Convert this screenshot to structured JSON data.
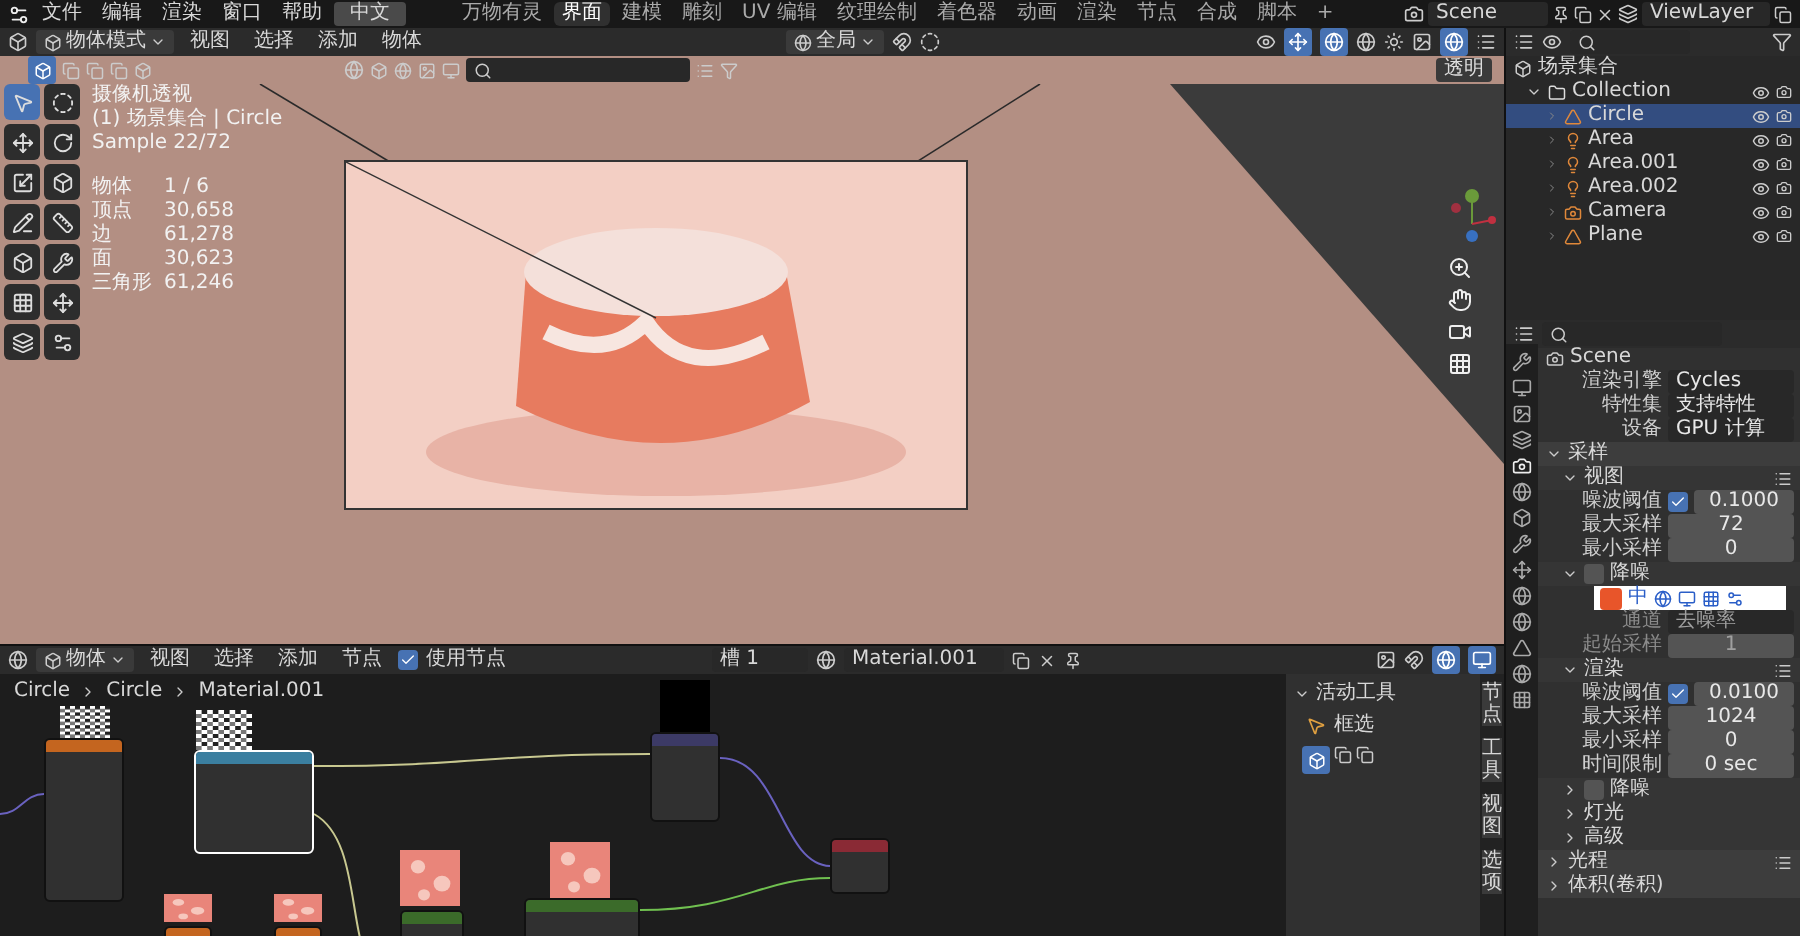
{
  "top_bar": {
    "menus": [
      {
        "label": "文件"
      },
      {
        "label": "编辑"
      },
      {
        "label": "渲染"
      },
      {
        "label": "窗口"
      },
      {
        "label": "帮助"
      }
    ],
    "language": "中文",
    "workspaces": [
      {
        "label": "万物有灵",
        "selected": false
      },
      {
        "label": "界面",
        "selected": true
      },
      {
        "label": "建模",
        "selected": false
      },
      {
        "label": "雕刻",
        "selected": false
      },
      {
        "label": "UV 编辑",
        "selected": false
      },
      {
        "label": "纹理绘制",
        "selected": false
      },
      {
        "label": "着色器",
        "selected": false
      },
      {
        "label": "动画",
        "selected": false
      },
      {
        "label": "渲染",
        "selected": false
      },
      {
        "label": "节点",
        "selected": false
      },
      {
        "label": "合成",
        "selected": false
      },
      {
        "label": "脚本",
        "selected": false
      },
      {
        "label": "+",
        "selected": false
      }
    ],
    "scene": "Scene",
    "view_layer": "ViewLayer"
  },
  "viewport": {
    "mode": "物体模式",
    "menus": [
      "视图",
      "选择",
      "添加",
      "物体"
    ],
    "orientation": "全局",
    "transparency": "透明",
    "tools": [
      {
        "selected": true
      },
      {
        "selected": false
      },
      {
        "selected": false
      },
      {
        "selected": false
      },
      {
        "selected": false
      },
      {
        "selected": false
      },
      {
        "selected": false
      },
      {
        "selected": false
      },
      {
        "selected": false
      },
      {
        "selected": false
      },
      {
        "selected": false
      },
      {
        "selected": false
      },
      {
        "selected": false
      },
      {
        "selected": false
      }
    ],
    "overlay_lines": [
      "摄像机透视",
      "(1) 场景集合 | Circle",
      "Sample 22/72"
    ],
    "stats": [
      {
        "label": "物体",
        "value": "1 / 6"
      },
      {
        "label": "顶点",
        "value": "30,658"
      },
      {
        "label": "边",
        "value": "61,278"
      },
      {
        "label": "面",
        "value": "30,623"
      },
      {
        "label": "三角形",
        "value": "61,246"
      }
    ]
  },
  "outliner": {
    "root": "场景集合",
    "items": [
      {
        "label": "Collection",
        "kind": "collection",
        "selected": false,
        "expanded": true,
        "children": [
          {
            "label": "Circle",
            "kind": "mesh",
            "selected": true
          },
          {
            "label": "Area",
            "kind": "light",
            "selected": false
          },
          {
            "label": "Area.001",
            "kind": "light",
            "selected": false
          },
          {
            "label": "Area.002",
            "kind": "light",
            "selected": false
          },
          {
            "label": "Camera",
            "kind": "camera",
            "selected": false
          },
          {
            "label": "Plane",
            "kind": "mesh",
            "selected": false
          }
        ]
      }
    ]
  },
  "properties": {
    "context": "Scene",
    "rows": [
      {
        "kind": "select",
        "label": "渲染引擎",
        "value": "Cycles",
        "disabled": false
      },
      {
        "kind": "select",
        "label": "特性集",
        "value": "支持特性",
        "disabled": false
      },
      {
        "kind": "select",
        "label": "设备",
        "value": "GPU 计算",
        "disabled": false
      },
      {
        "kind": "panel",
        "label": "采样",
        "expanded": true,
        "has_presets": false
      },
      {
        "kind": "subpanel",
        "label": "视图",
        "expanded": true,
        "has_presets": true
      },
      {
        "kind": "check_number",
        "label": "噪波阈值",
        "checked": true,
        "value": "0.1000",
        "disabled": false
      },
      {
        "kind": "number",
        "label": "最大采样",
        "value": "72",
        "disabled": false
      },
      {
        "kind": "number",
        "label": "最小采样",
        "value": "0",
        "disabled": false
      },
      {
        "kind": "toggle_panel",
        "label": "降噪",
        "expanded": true,
        "checked": false
      },
      {
        "kind": "ime",
        "label": "中"
      },
      {
        "kind": "select",
        "label": "通道",
        "value": "去噪率",
        "disabled": true
      },
      {
        "kind": "number",
        "label": "起始采样",
        "value": "1",
        "disabled": true
      },
      {
        "kind": "subpanel",
        "label": "渲染",
        "expanded": true,
        "has_presets": true
      },
      {
        "kind": "check_number",
        "label": "噪波阈值",
        "checked": true,
        "value": "0.0100",
        "disabled": false
      },
      {
        "kind": "number",
        "label": "最大采样",
        "value": "1024",
        "disabled": false
      },
      {
        "kind": "number",
        "label": "最小采样",
        "value": "0",
        "disabled": false
      },
      {
        "kind": "number",
        "label": "时间限制",
        "value": "0 sec",
        "disabled": false
      },
      {
        "kind": "toggle_panel",
        "label": "降噪",
        "expanded": false,
        "checked": false
      },
      {
        "kind": "subpanel",
        "label": "灯光",
        "expanded": false,
        "has_presets": false
      },
      {
        "kind": "subpanel",
        "label": "高级",
        "expanded": false,
        "has_presets": false
      },
      {
        "kind": "panel",
        "label": "光程",
        "expanded": false,
        "has_presets": true
      },
      {
        "kind": "panel",
        "label": "体积(卷积)",
        "expanded": false,
        "has_presets": false
      }
    ]
  },
  "node_editor": {
    "mode": "物体",
    "menus": [
      "视图",
      "选择",
      "添加",
      "节点"
    ],
    "use_nodes": {
      "label": "使用节点",
      "checked": true
    },
    "slot": "槽 1",
    "material": "Material.001",
    "breadcrumb": [
      "Circle",
      "Circle",
      "Material.001"
    ],
    "sidebar": {
      "title": "活动工具",
      "tool": "框选",
      "tabs": [
        "节点",
        "工具",
        "视图",
        "选项"
      ]
    },
    "nodes": [
      {
        "kind": "texture",
        "preview": {
          "kind": "noise"
        },
        "selected": false
      },
      {
        "kind": "color",
        "preview": {
          "kind": "noise"
        },
        "selected": true
      },
      {
        "kind": "converter",
        "preview": {
          "kind": "black"
        },
        "selected": false
      },
      {
        "kind": "output",
        "selected": false
      },
      {
        "kind": "shader",
        "preview": {
          "kind": "pink"
        },
        "selected": false
      },
      {
        "kind": "shader",
        "preview": {
          "kind": "pink"
        },
        "selected": false
      },
      {
        "kind": "texture",
        "preview": {
          "kind": "pink"
        },
        "selected": false
      },
      {
        "kind": "texture",
        "preview": {
          "kind": "pink"
        },
        "selected": false
      }
    ]
  }
}
